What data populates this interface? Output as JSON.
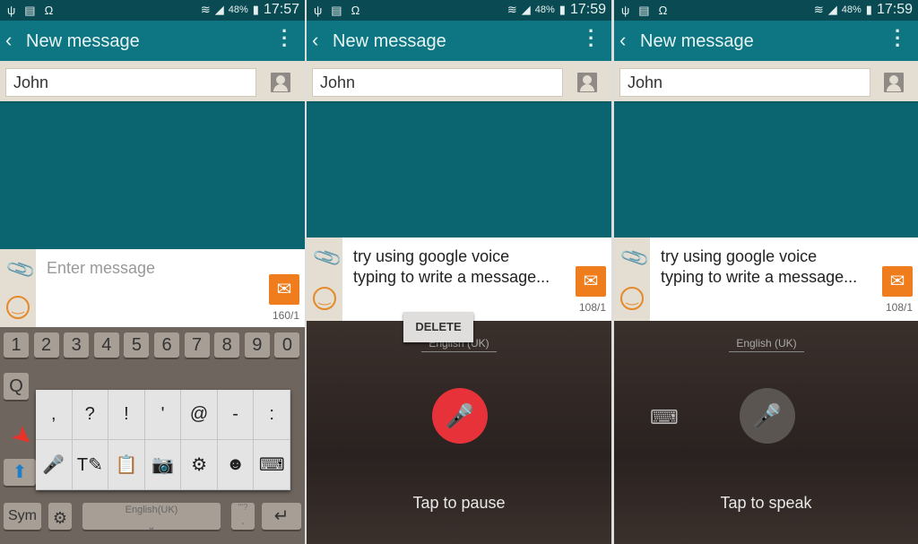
{
  "panels": [
    {
      "time": "17:57",
      "battery": "48%",
      "title": "New message",
      "recipient": "John",
      "placeholder": "Enter message",
      "counter": "160/1"
    },
    {
      "time": "17:59",
      "battery": "48%",
      "title": "New message",
      "recipient": "John",
      "message": " try using google voice typing to write a message...",
      "counter": "108/1",
      "delete_label": "DELETE",
      "language": "English (UK)",
      "voice_status": "Tap to pause",
      "mic_color": "#e8323a"
    },
    {
      "time": "17:59",
      "battery": "48%",
      "title": "New message",
      "recipient": "John",
      "message": " try using google voice typing to write a message...",
      "counter": "108/1",
      "language": "English (UK)",
      "voice_status": "Tap to speak",
      "mic_color": "#5b5552"
    }
  ],
  "keyboard": {
    "number_row": [
      "1",
      "2",
      "3",
      "4",
      "5",
      "6",
      "7",
      "8",
      "9",
      "0"
    ],
    "q_key": "Q",
    "popup_symbols": [
      ",",
      "?",
      "!",
      "'",
      "@",
      "-",
      ":"
    ],
    "popup_tools": [
      "mic-icon",
      "handwriting-icon",
      "clipboard-icon",
      "camera-text-icon",
      "settings-icon",
      "emoji-icon",
      "keyboard-icon"
    ],
    "sym_label": "Sym",
    "space_label": "English(UK)",
    "period_label": ".",
    "period_hint": "'\"?"
  },
  "colors": {
    "header": "#0e7682",
    "status": "#0a4b53",
    "send": "#ef7d1e",
    "annotation_arrow": "#e8322a"
  }
}
